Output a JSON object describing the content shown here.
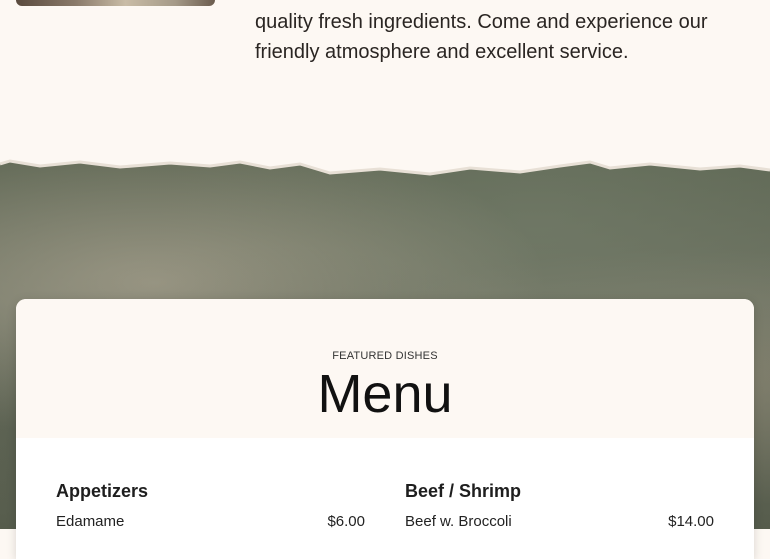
{
  "about": {
    "text_line1": "quality fresh ingredients. Come and experience our",
    "text_line2": "friendly atmosphere and excellent service."
  },
  "menu": {
    "eyebrow": "FEATURED DISHES",
    "title": "Menu",
    "categories": [
      {
        "name": "Appetizers",
        "items": [
          {
            "name": "Edamame",
            "price": "$6.00"
          }
        ]
      },
      {
        "name": "Beef / Shrimp",
        "items": [
          {
            "name": "Beef w. Broccoli",
            "price": "$14.00"
          }
        ]
      }
    ]
  }
}
